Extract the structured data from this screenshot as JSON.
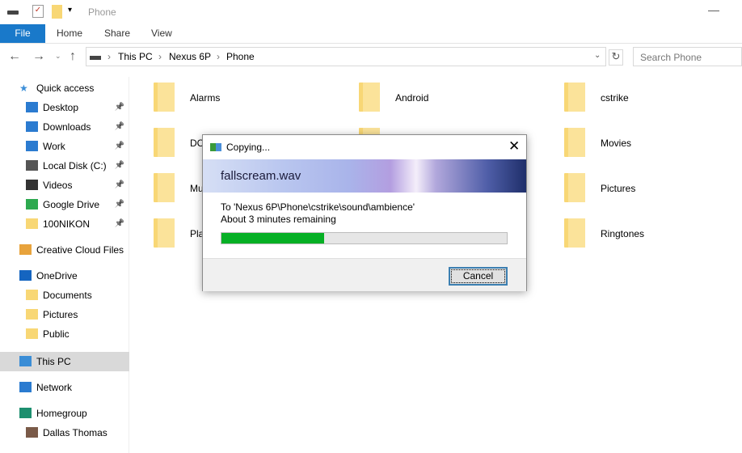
{
  "window": {
    "title": "Phone"
  },
  "ribbon": {
    "tabs": [
      "File",
      "Home",
      "Share",
      "View"
    ]
  },
  "address": {
    "crumbs": [
      "This PC",
      "Nexus 6P",
      "Phone"
    ],
    "search_placeholder": "Search Phone"
  },
  "sidebar": {
    "items": [
      {
        "label": "Quick access",
        "icon": "star-icon",
        "pinned": false,
        "indent": false
      },
      {
        "label": "Desktop",
        "icon": "desktop-icon",
        "pinned": true,
        "indent": true
      },
      {
        "label": "Downloads",
        "icon": "download-icon",
        "pinned": true,
        "indent": true
      },
      {
        "label": "Work",
        "icon": "monitor-icon",
        "pinned": true,
        "indent": true
      },
      {
        "label": "Local Disk (C:)",
        "icon": "drive-icon",
        "pinned": true,
        "indent": true
      },
      {
        "label": "Videos",
        "icon": "film-icon",
        "pinned": true,
        "indent": true
      },
      {
        "label": "Google Drive",
        "icon": "google-drive-icon",
        "pinned": true,
        "indent": true
      },
      {
        "label": "100NIKON",
        "icon": "folder-icon",
        "pinned": true,
        "indent": true
      },
      {
        "label": "Creative Cloud Files",
        "icon": "creative-cloud-icon",
        "pinned": false,
        "indent": false
      },
      {
        "label": "OneDrive",
        "icon": "cloud-icon",
        "pinned": false,
        "indent": false
      },
      {
        "label": "Documents",
        "icon": "folder-icon",
        "pinned": false,
        "indent": true
      },
      {
        "label": "Pictures",
        "icon": "folder-icon",
        "pinned": false,
        "indent": true
      },
      {
        "label": "Public",
        "icon": "folder-icon",
        "pinned": false,
        "indent": true
      },
      {
        "label": "This PC",
        "icon": "computer-icon",
        "pinned": false,
        "indent": false,
        "selected": true
      },
      {
        "label": "Network",
        "icon": "network-icon",
        "pinned": false,
        "indent": false
      },
      {
        "label": "Homegroup",
        "icon": "homegroup-icon",
        "pinned": false,
        "indent": false
      },
      {
        "label": "Dallas Thomas",
        "icon": "user-avatar-icon",
        "pinned": false,
        "indent": true
      }
    ]
  },
  "folders": [
    {
      "label": "Alarms"
    },
    {
      "label": "Android"
    },
    {
      "label": "cstrike"
    },
    {
      "label": "DC"
    },
    {
      "label": ""
    },
    {
      "label": "Movies"
    },
    {
      "label": "Mu"
    },
    {
      "label": ""
    },
    {
      "label": "Pictures"
    },
    {
      "label": "Pla"
    },
    {
      "label": ""
    },
    {
      "label": "Ringtones"
    }
  ],
  "dialog": {
    "title": "Copying...",
    "filename": "fallscream.wav",
    "destination": "To 'Nexus 6P\\Phone\\cstrike\\sound\\ambience'",
    "remaining": "About 3 minutes remaining",
    "progress_percent": 36,
    "cancel_label": "Cancel",
    "progress_color": "#06b025"
  }
}
